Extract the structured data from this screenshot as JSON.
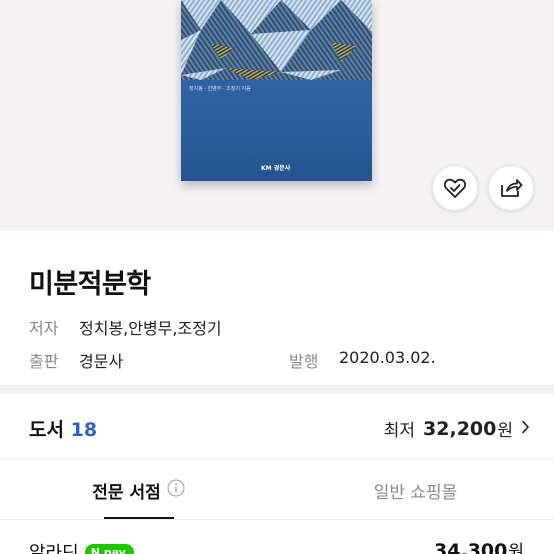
{
  "book": {
    "title": "미분적분학",
    "author_label": "저자",
    "authors": "정치봉,안병무,조정기",
    "publisher_label": "출판",
    "publisher": "경문사",
    "published_label": "발행",
    "published_date": "2020.03.02."
  },
  "cover": {
    "authors_text": "정치봉 · 안병무 · 조정기 지음",
    "publisher_text": "KM 경문사",
    "colors": {
      "band": "#2a5d9b",
      "pattern_light": "#9bb8d8",
      "pattern_dark": "#3d5f86",
      "accent_gold": "#c9b64a"
    }
  },
  "actions": {
    "wish_icon": "heart-check-icon",
    "share_icon": "share-icon"
  },
  "offers": {
    "label": "도서",
    "count": "18",
    "lowest_label": "최저",
    "lowest_price": "32,200",
    "currency": "원"
  },
  "tabs": [
    {
      "label": "전문 서점",
      "active": true
    },
    {
      "label": "일반 쇼핑몰",
      "active": false
    }
  ],
  "stores": [
    {
      "name": "알라딘",
      "badge": "N pay",
      "price": "34,300",
      "currency": "원"
    }
  ],
  "colors": {
    "accent_blue": "#2b62c9",
    "npay_green": "#1ec800"
  }
}
